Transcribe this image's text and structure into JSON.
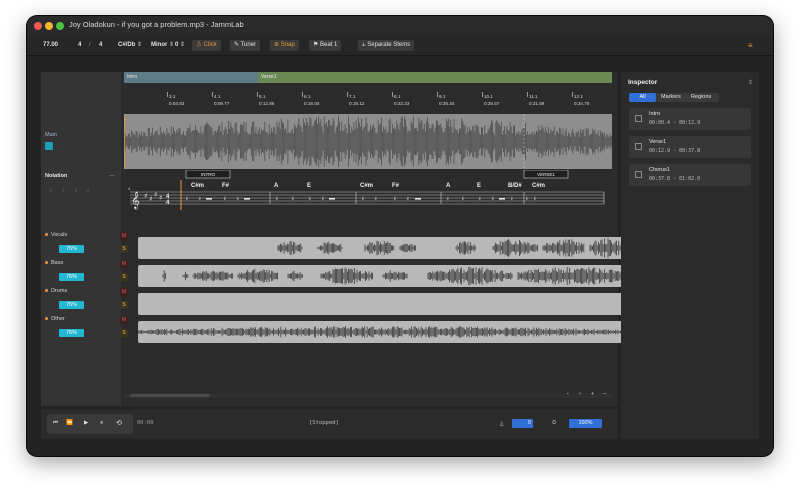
{
  "window": {
    "title": "Joy Oladokun - if you got a problem.mp3 - JammLab"
  },
  "toolbar": {
    "bpm": "77.00",
    "time_sig_num": "4",
    "time_sig_sep": "/",
    "time_sig_den": "4",
    "key": "C#/Db",
    "mode": "Minor",
    "offset": "0",
    "click": "Click",
    "tuner": "Tuner",
    "snap": "Snap",
    "beat": "Beat 1",
    "separate_stems": "Separate Stems"
  },
  "timeline": {
    "regions": [
      "Intro",
      "Verse1"
    ],
    "bars": [
      {
        "num": "3.1",
        "time": "0:04.83"
      },
      {
        "num": "4.1",
        "time": "0:09.77"
      },
      {
        "num": "5.1",
        "time": "0:12.86"
      },
      {
        "num": "6.1",
        "time": "0:16.00"
      },
      {
        "num": "7.1",
        "time": "0:19.12"
      },
      {
        "num": "8.1",
        "time": "0:22.23"
      },
      {
        "num": "9.1",
        "time": "0:26.34"
      },
      {
        "num": "10.1",
        "time": "0:28.57"
      },
      {
        "num": "11.1",
        "time": "0:31.59"
      },
      {
        "num": "12.1",
        "time": "0:34.70"
      }
    ]
  },
  "left": {
    "main_label": "Main",
    "notation_label": "Notation",
    "notation_collapse": "—"
  },
  "notation": {
    "sections": [
      "INTRO",
      "VERSE1"
    ],
    "chords": [
      "C#m",
      "F#",
      "A",
      "E",
      "C#m",
      "F#",
      "A",
      "E",
      "B/D#",
      "C#m"
    ],
    "time_sig_top": "4",
    "time_sig_bottom": "4",
    "measure": "4"
  },
  "tracks": [
    {
      "name": "Vocals",
      "volume": "75%",
      "mute": "M",
      "solo": "S"
    },
    {
      "name": "Bass",
      "volume": "75%",
      "mute": "M",
      "solo": "S"
    },
    {
      "name": "Drums",
      "volume": "75%",
      "mute": "M",
      "solo": "S"
    },
    {
      "name": "Other",
      "volume": "75%",
      "mute": "M",
      "solo": "S"
    }
  ],
  "zoom_controls": [
    "‹",
    "›",
    "+",
    "−"
  ],
  "transport": {
    "time": "00:00",
    "status": "[Stopped]",
    "pitch_value": "0",
    "speed_value": "100%"
  },
  "inspector": {
    "title": "Inspector",
    "tabs": [
      "All",
      "Markers",
      "Regions"
    ],
    "items": [
      {
        "name": "Intro",
        "range": "00:00.4 - 00:12.9"
      },
      {
        "name": "Verse1",
        "range": "00:12.9 - 00:37.8"
      },
      {
        "name": "Chorus1",
        "range": "00:37.8 - 01:02.0"
      }
    ]
  },
  "colors": {
    "accent": "#22b8d3",
    "orange": "#e8953c",
    "region_intro": "#5d7c87",
    "region_verse": "#6a8a55",
    "tab_active": "#2f6fd6"
  }
}
